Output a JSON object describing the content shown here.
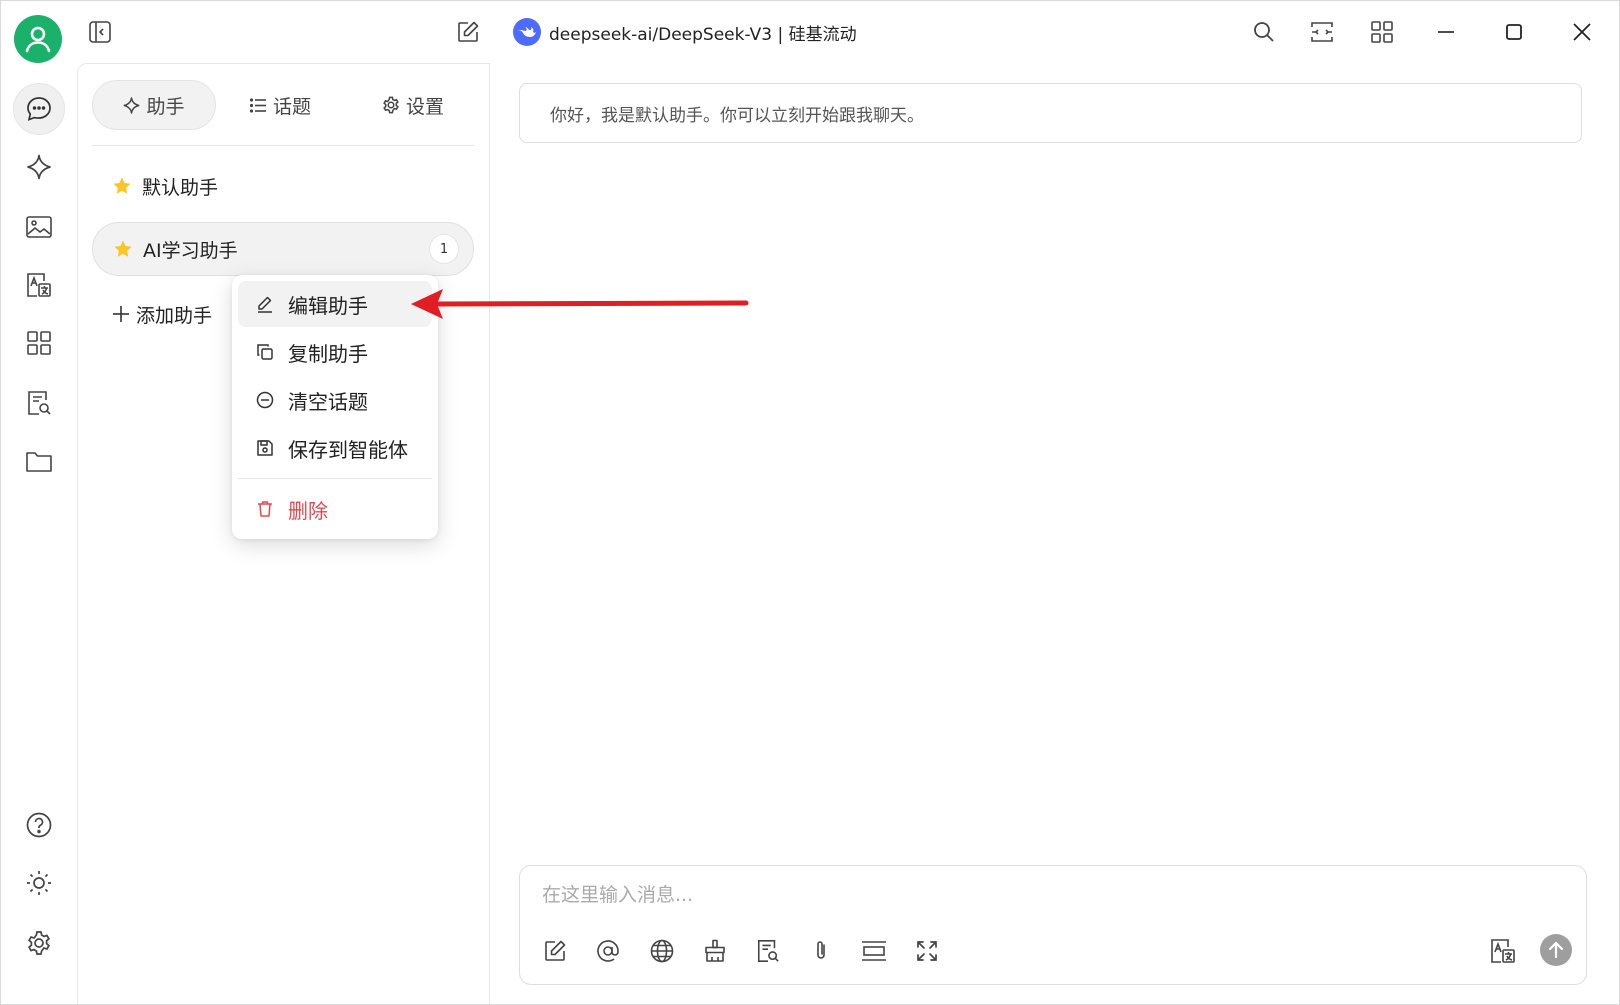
{
  "app": {
    "model_title": "deepseek-ai/DeepSeek-V3 | 硅基流动",
    "brand_color": "#1ab26b",
    "model_logo_color": "#4d6bfe"
  },
  "topbar": {
    "icons": [
      "sidebar-collapse-icon",
      "new-chat-icon",
      "search-icon",
      "fit-width-icon",
      "grid-view-icon",
      "minimize-icon",
      "maximize-icon",
      "close-icon"
    ]
  },
  "rail": {
    "items": [
      "chat-icon",
      "sparkle-icon",
      "image-icon",
      "translate-icon",
      "apps-icon",
      "document-search-icon",
      "folder-icon"
    ],
    "bottom": [
      "help-icon",
      "theme-icon",
      "settings-icon"
    ]
  },
  "panel": {
    "tabs": [
      {
        "label": "助手",
        "icon": "sparkle-icon"
      },
      {
        "label": "话题",
        "icon": "list-icon"
      },
      {
        "label": "设置",
        "icon": "gear-icon"
      }
    ],
    "assistants": [
      {
        "name": "默认助手",
        "icon": "star-icon"
      },
      {
        "name": "AI学习助手",
        "icon": "star-icon",
        "badge": "1"
      }
    ],
    "add_label": "添加助手"
  },
  "context_menu": {
    "items": [
      {
        "label": "编辑助手",
        "icon": "edit-icon"
      },
      {
        "label": "复制助手",
        "icon": "copy-icon"
      },
      {
        "label": "清空话题",
        "icon": "clear-icon"
      },
      {
        "label": "保存到智能体",
        "icon": "save-icon"
      }
    ],
    "delete_label": "删除",
    "danger_color": "#e5484d"
  },
  "annotation": {
    "arrow_color": "#e01e25"
  },
  "chat": {
    "greeting": "你好，我是默认助手。你可以立刻开始跟我聊天。",
    "input_placeholder": "在这里输入消息..."
  }
}
